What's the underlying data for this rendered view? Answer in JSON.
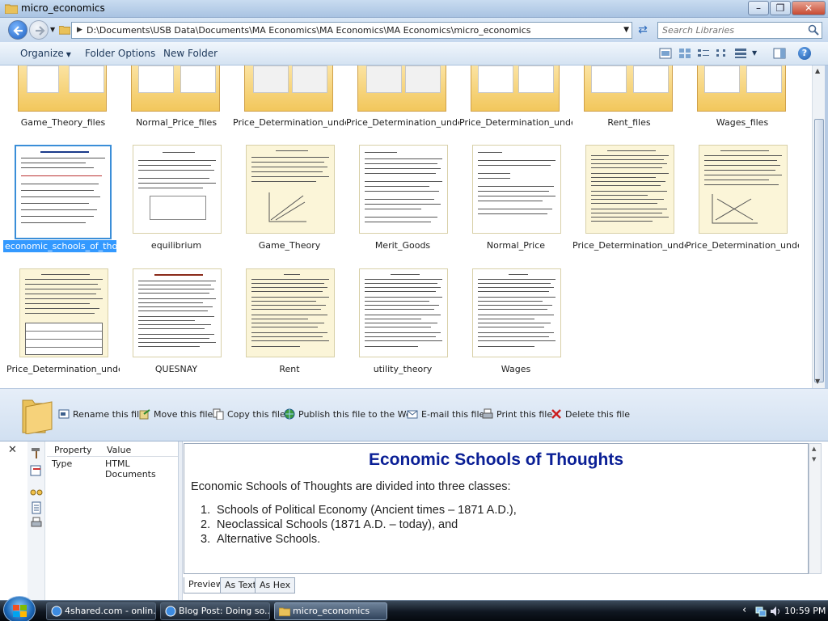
{
  "window": {
    "title": "micro_economics",
    "controls": {
      "minimize": "–",
      "maximize": "❐",
      "close": "✕"
    }
  },
  "address": {
    "path": "D:\\Documents\\USB Data\\Documents\\MA Economics\\MA Economics\\MA Economics\\micro_economics",
    "search_placeholder": "Search Libraries"
  },
  "toolbar": {
    "organize": "Organize",
    "folder_options": "Folder Options",
    "new_folder": "New Folder",
    "help": "?"
  },
  "folders": [
    {
      "label": "Game_Theory_files"
    },
    {
      "label": "Normal_Price_files"
    },
    {
      "label": "Price_Determination_unde..."
    },
    {
      "label": "Price_Determination_unde..."
    },
    {
      "label": "Price_Determination_unde..."
    },
    {
      "label": "Rent_files"
    },
    {
      "label": "Wages_files"
    }
  ],
  "files_row1": [
    {
      "label": "economic_schools_of_thoughts",
      "selected": true
    },
    {
      "label": "equilibrium"
    },
    {
      "label": "Game_Theory"
    },
    {
      "label": "Merit_Goods"
    },
    {
      "label": "Normal_Price"
    },
    {
      "label": "Price_Determination_unde..."
    },
    {
      "label": "Price_Determination_unde..."
    }
  ],
  "files_row2": [
    {
      "label": "Price_Determination_unde..."
    },
    {
      "label": "QUESNAY"
    },
    {
      "label": "Rent"
    },
    {
      "label": "utility_theory"
    },
    {
      "label": "Wages"
    }
  ],
  "commands": {
    "rename": "Rename this file",
    "move": "Move this file",
    "copy": "Copy this file",
    "publish": "Publish this file to the Web",
    "email": "E-mail this file",
    "print": "Print this file",
    "delete": "Delete this file"
  },
  "properties": {
    "close": "✕",
    "header_property": "Property",
    "header_value": "Value",
    "row_property": "Type",
    "row_value": "HTML Documents"
  },
  "preview": {
    "heading": "Economic Schools of Thoughts",
    "intro": "Economic Schools of Thoughts are divided into three classes:",
    "items": [
      {
        "num": "1.",
        "text": "Schools of Political Economy (Ancient times – 1871 A.D.),"
      },
      {
        "num": "2.",
        "text": "Neoclassical Schools (1871 A.D. – today), and"
      },
      {
        "num": "3.",
        "text": "Alternative Schools."
      }
    ],
    "tabs": [
      "Preview",
      "As Text",
      "As Hex"
    ]
  },
  "taskbar": {
    "tasks": [
      {
        "label": "4shared.com - onlin..."
      },
      {
        "label": "Blog Post: Doing so..."
      },
      {
        "label": "micro_economics"
      }
    ],
    "clock": "10:59 PM",
    "tray_arrow": "‹"
  },
  "colors": {
    "selection": "#3399ff",
    "heading_blue": "#0a1f96",
    "delete_red": "#cc1f1f"
  }
}
